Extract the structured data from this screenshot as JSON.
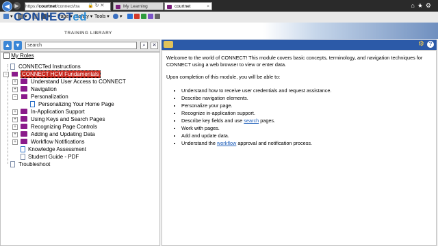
{
  "browser": {
    "address": {
      "prefix": "https://",
      "host": "courtnet",
      "path": "/connect/tra"
    },
    "tabs": [
      {
        "label": "My Learning"
      },
      {
        "label": "courtnet"
      }
    ],
    "command_bar": {
      "page": "Page ▾",
      "safety": "Safety ▾",
      "tools": "Tools ▾"
    }
  },
  "banner": {
    "logo_main": "CONNECT",
    "logo_accent": "ed",
    "subtitle": "TRAINING LIBRARY"
  },
  "search": {
    "value": "search"
  },
  "tree": {
    "my_roles": "My Roles",
    "items": [
      {
        "label": "CONNECTed Instructions"
      },
      {
        "label": "CONNECT HCM Fundamentals"
      },
      {
        "label": "Understand User Access to CONNECT"
      },
      {
        "label": "Navigation"
      },
      {
        "label": "Personalization"
      },
      {
        "label": "Personalizing Your Home Page"
      },
      {
        "label": "In-Application Support"
      },
      {
        "label": "Using Keys and Search Pages"
      },
      {
        "label": "Recognizing Page Controls"
      },
      {
        "label": "Adding and Updating Data"
      },
      {
        "label": "Workflow Notifications"
      },
      {
        "label": "Knowledge Assessment"
      },
      {
        "label": "Student Guide - PDF"
      },
      {
        "label": "Troubleshoot"
      }
    ]
  },
  "content": {
    "intro": "Welcome to the world of CONNECT! This module covers basic concepts, terminology, and navigation techniques for CONNECT using a web browser to view or enter data.",
    "completion": "Upon completion of this module, you will be able to:",
    "bullets": {
      "b1": "Understand how to receive user credentials and request assistance.",
      "b2": "Describe navigation elements.",
      "b3": "Personalize your page.",
      "b4": "Recognize in-application support.",
      "b5_pre": "Describe key fields and use ",
      "b5_link": "search",
      "b5_post": " pages.",
      "b6": "Work with pages.",
      "b7": "Add and update data.",
      "b8_pre": "Understand the ",
      "b8_link": "workflow",
      "b8_post": " approval and notification process."
    }
  }
}
